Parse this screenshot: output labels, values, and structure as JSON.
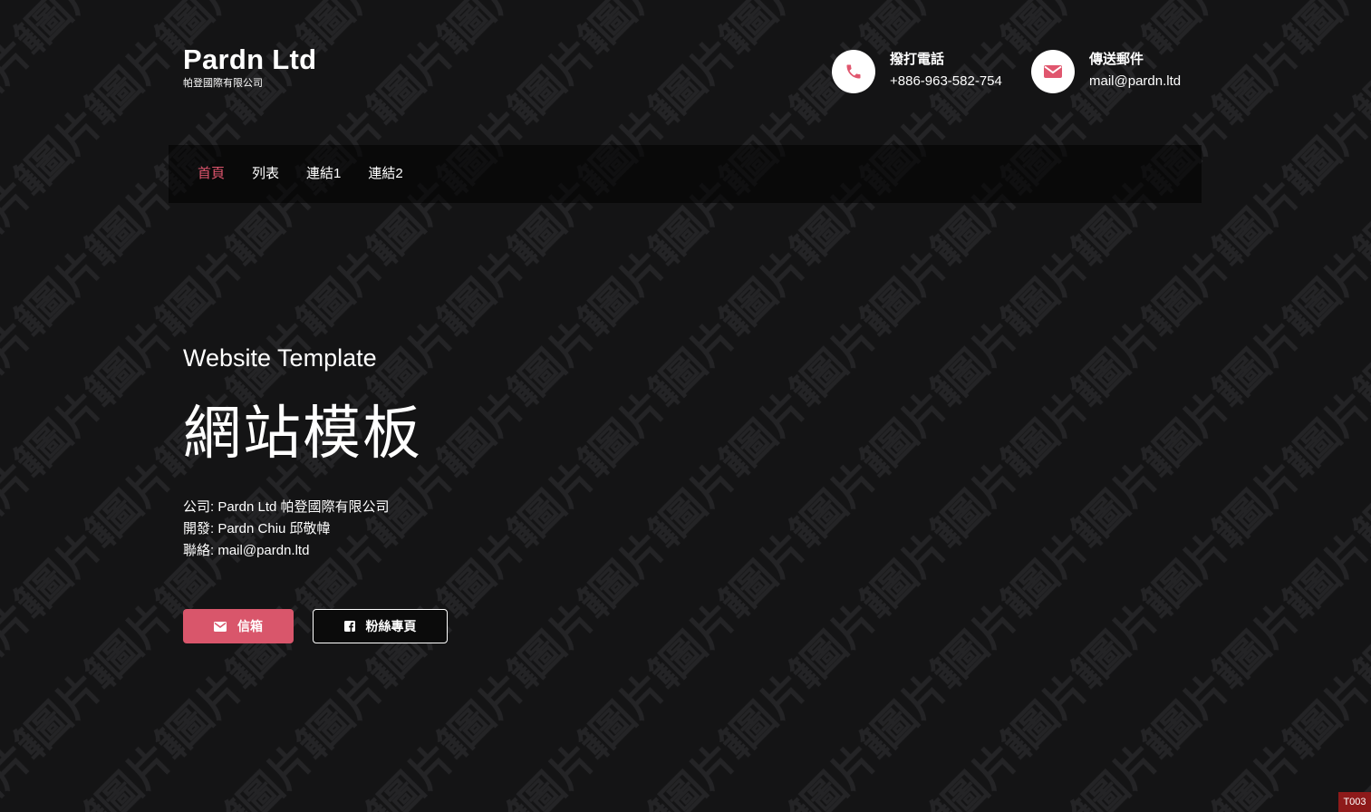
{
  "colors": {
    "accent": "#e0566e",
    "button": "#d9566b",
    "background": "#141415",
    "nav_bg": "#000000"
  },
  "watermark_text": "圖片範例",
  "header": {
    "brand_name": "Pardn Ltd",
    "brand_sub": "帕登國際有限公司",
    "phone": {
      "icon": "phone-icon",
      "title": "撥打電話",
      "value": "+886-963-582-754"
    },
    "mail": {
      "icon": "envelope-icon",
      "title": "傳送郵件",
      "value": "mail@pardn.ltd"
    }
  },
  "nav": {
    "items": [
      {
        "label": "首頁",
        "active": true
      },
      {
        "label": "列表",
        "active": false
      },
      {
        "label": "連結1",
        "active": false
      },
      {
        "label": "連結2",
        "active": false
      }
    ]
  },
  "hero": {
    "subtitle": "Website Template",
    "title": "網站模板",
    "info": [
      "公司: Pardn Ltd 帕登國際有限公司",
      "開發: Pardn Chiu 邱敬幃",
      "聯絡: mail@pardn.ltd"
    ],
    "buttons": {
      "mail_label": "信箱",
      "fanpage_label": "粉絲專頁"
    }
  },
  "corner_tag": "T003"
}
